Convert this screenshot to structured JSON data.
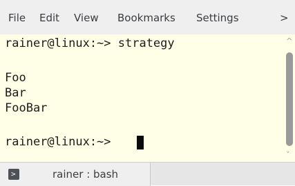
{
  "menubar": {
    "items": [
      {
        "label": "File"
      },
      {
        "label": "Edit"
      },
      {
        "label": "View"
      },
      {
        "label": "Bookmarks"
      },
      {
        "label": "Settings"
      }
    ],
    "overflow_label": ">"
  },
  "terminal": {
    "lines": [
      "rainer@linux:~> strategy",
      "Foo",
      "Bar",
      "FooBar",
      "rainer@linux:~> "
    ],
    "background_color": "#fffee6",
    "text_color": "#1c1c1c"
  },
  "scrollbar": {
    "up_icon": "chevron-up-icon",
    "down_icon": "chevron-down-icon",
    "up_glyph": "^",
    "down_glyph": "˅"
  },
  "tabs": [
    {
      "label": "rainer : bash",
      "icon": "terminal-icon",
      "icon_glyph": ">"
    }
  ]
}
